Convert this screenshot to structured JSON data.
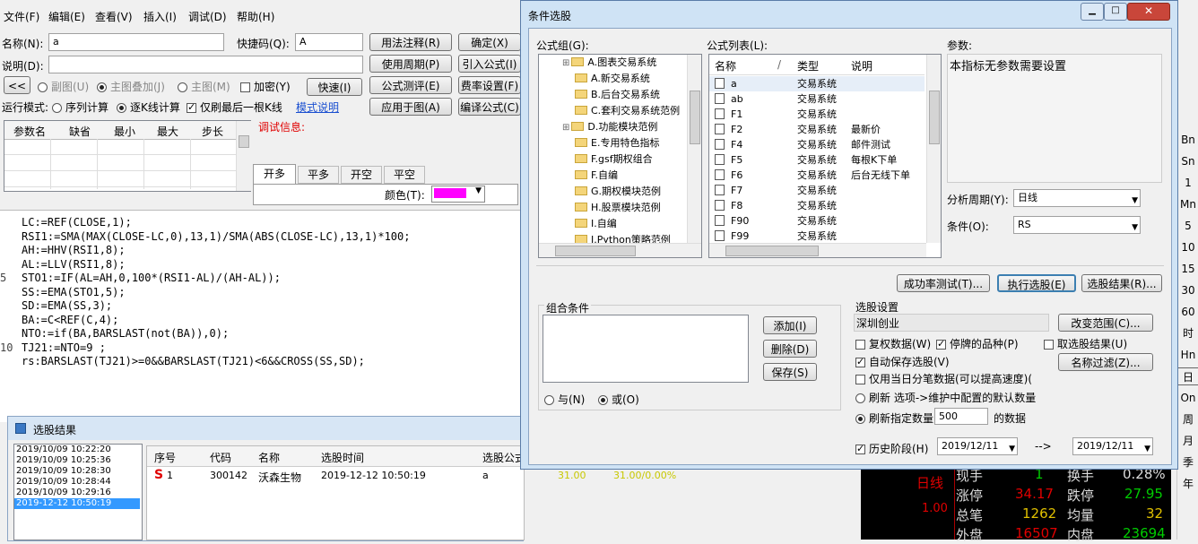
{
  "menu": [
    "文件(F)",
    "编辑(E)",
    "查看(V)",
    "插入(I)",
    "调试(D)",
    "帮助(H)"
  ],
  "editor": {
    "name_label": "名称(N):",
    "name_value": "a",
    "shortcut_label": "快捷码(Q):",
    "shortcut_value": "A",
    "desc_label": "说明(D):",
    "btn_usage": "用法注释(R)",
    "btn_ok": "确定(X)",
    "btn_period": "使用周期(P)",
    "btn_import": "引入公式(I)",
    "btn_test": "公式测评(E)",
    "btn_fee": "费率设置(F)",
    "btn_apply": "应用于图(A)",
    "btn_compile": "编译公式(C)",
    "btn_back": "<<",
    "radio_subchart": "副图(U)",
    "radio_overlay": "主图叠加(J)",
    "radio_main": "主图(M)",
    "cb_encrypt": "加密(Y)",
    "btn_quick": "快速(I)",
    "run_mode_label": "运行模式:",
    "rm_seq": "序列计算",
    "rm_line": "逐K线计算",
    "rm_last": "仅刷最后一根K线",
    "rm_help": "模式说明",
    "param_headers": [
      "参数名",
      "缺省",
      "最小",
      "最大",
      "步长"
    ],
    "debug_label": "调试信息:",
    "tabs": [
      "开多",
      "平多",
      "开空",
      "平空"
    ],
    "color_label": "颜色(T):",
    "color_value": "#ff00ff",
    "code": [
      {
        "n": "",
        "t": "LC:=REF(CLOSE,1);"
      },
      {
        "n": "",
        "t": "RSI1:=SMA(MAX(CLOSE-LC,0),13,1)/SMA(ABS(CLOSE-LC),13,1)*100;"
      },
      {
        "n": "",
        "t": "AH:=HHV(RSI1,8);"
      },
      {
        "n": "",
        "t": "AL:=LLV(RSI1,8);"
      },
      {
        "n": "5",
        "t": "STO1:=IF(AL=AH,0,100*(RSI1-AL)/(AH-AL));"
      },
      {
        "n": "",
        "t": "SS:=EMA(STO1,5);"
      },
      {
        "n": "",
        "t": "SD:=EMA(SS,3);"
      },
      {
        "n": "",
        "t": "BA:=C<REF(C,4);"
      },
      {
        "n": "",
        "t": "NTO:=if(BA,BARSLAST(not(BA)),0);"
      },
      {
        "n": "10",
        "t": "TJ21:=NTO=9 ;"
      },
      {
        "n": "",
        "t": "rs:BARSLAST(TJ21)>=0&&BARSLAST(TJ21)<6&&CROSS(SS,SD);"
      }
    ]
  },
  "results": {
    "title": "选股结果",
    "times": [
      "2019/10/09 10:22:20",
      "2019/10/09 10:25:36",
      "2019/10/09 10:28:30",
      "2019/10/09 10:28:44",
      "2019/10/09 10:29:16",
      "2019-12-12 10:50:19"
    ],
    "headers": [
      "序号",
      "代码",
      "名称",
      "选股时间",
      "选股公式"
    ],
    "row": {
      "flag": "S",
      "no": "1",
      "code": "300142",
      "name": "沃森生物",
      "time": "2019-12-12 10:50:19",
      "formula": "a",
      "price": "31.00",
      "change": "31.00/0.00%"
    }
  },
  "dialog": {
    "title": "条件选股",
    "group_label": "公式组(G):",
    "groups": [
      "A.图表交易系统",
      "A.新交易系统",
      "B.后台交易系统",
      "C.套利交易系统范例",
      "D.功能模块范例",
      "E.专用特色指标",
      "F.gsf期权组合",
      "F.自编",
      "G.期权模块范例",
      "H.股票模块范例",
      "I.自编",
      "J.Python策略范例"
    ],
    "list_label": "公式列表(L):",
    "list_headers": [
      "名称",
      "类型",
      "说明"
    ],
    "formulas": [
      {
        "name": "a",
        "type": "交易系统",
        "desc": ""
      },
      {
        "name": "ab",
        "type": "交易系统",
        "desc": ""
      },
      {
        "name": "F1",
        "type": "交易系统",
        "desc": ""
      },
      {
        "name": "F2",
        "type": "交易系统",
        "desc": "最新价"
      },
      {
        "name": "F4",
        "type": "交易系统",
        "desc": "邮件测试"
      },
      {
        "name": "F5",
        "type": "交易系统",
        "desc": "每根K下单"
      },
      {
        "name": "F6",
        "type": "交易系统",
        "desc": "后台无线下单"
      },
      {
        "name": "F7",
        "type": "交易系统",
        "desc": ""
      },
      {
        "name": "F8",
        "type": "交易系统",
        "desc": ""
      },
      {
        "name": "F90",
        "type": "交易系统",
        "desc": ""
      },
      {
        "name": "F99",
        "type": "交易系统",
        "desc": ""
      }
    ],
    "param_label": "参数:",
    "param_text": "本指标无参数需要设置",
    "period_label": "分析周期(Y):",
    "period_value": "日线",
    "cond_label": "条件(O):",
    "cond_value": "RS",
    "btn_success": "成功率测试(T)...",
    "btn_run": "执行选股(E)",
    "btn_result": "选股结果(R)...",
    "combo_label": "组合条件",
    "btn_add": "添加(I)",
    "btn_del": "删除(D)",
    "btn_save": "保存(S)",
    "radio_and": "与(N)",
    "radio_or": "或(O)",
    "settings_label": "选股设置",
    "range_value": "深圳创业",
    "btn_range": "改变范围(C)...",
    "cb_restore": "复权数据(W)",
    "cb_suspended": "停牌的品种(P)",
    "cb_take": "取选股结果(U)",
    "cb_autosave": "自动保存选股(V)",
    "btn_filter": "名称过滤(Z)...",
    "cb_intraday": "仅用当日分笔数据(可以提高速度)(",
    "rb_refresh_default": "刷新 选项->维护中配置的默认数量",
    "rb_refresh_count": "刷新指定数量",
    "count_value": "500",
    "count_suffix": "的数据",
    "cb_history": "历史阶段(H)",
    "date_from": "2019/12/11",
    "date_arrow": "-->",
    "date_to": "2019/12/11"
  },
  "quotes": {
    "period": "日线",
    "price_level": "1.00",
    "rows": [
      {
        "l1": "现手",
        "v1": "1",
        "l2": "换手",
        "v2": "0.28%"
      },
      {
        "l1": "涨停",
        "v1": "34.17",
        "l2": "跌停",
        "v2": "27.95"
      },
      {
        "l1": "总笔",
        "v1": "1262",
        "l2": "均量",
        "v2": "32"
      },
      {
        "l1": "外盘",
        "v1": "16507",
        "l2": "内盘",
        "v2": "23694"
      }
    ]
  },
  "right_toolbar": [
    "Bn",
    "Sn",
    "1",
    "Mn",
    "5",
    "10",
    "15",
    "30",
    "60",
    "时",
    "Hn",
    "日",
    "On",
    "周",
    "月",
    "季",
    "年"
  ]
}
